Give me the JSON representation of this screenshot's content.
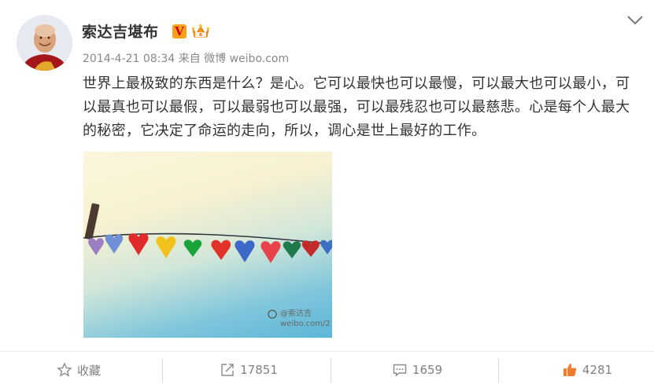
{
  "post": {
    "author": "索达吉堪布",
    "timestamp": "2014-4-21 08:34",
    "source_prefix": "来自",
    "source": "微博 weibo.com",
    "text": "世界上最极致的东西是什么？是心。它可以最快也可以最慢，可以最大也可以最小，可以最真也可以最假，可以最弱也可以最强，可以最残忍也可以最慈悲。心是每个人最大的秘密，它决定了命运的走向，所以，调心是世上最好的工作。",
    "badges": {
      "verified": "V",
      "verified_color": "#f7a11b"
    },
    "image": {
      "watermark_line1": "@索达吉",
      "watermark_line2": "weibo.com/2"
    }
  },
  "actions": {
    "favorite_label": "收藏",
    "repost_count": "17851",
    "comment_count": "1659",
    "like_count": "4281"
  },
  "colors": {
    "like": "#f07c2c",
    "text": "#333333",
    "meta": "#888888"
  }
}
